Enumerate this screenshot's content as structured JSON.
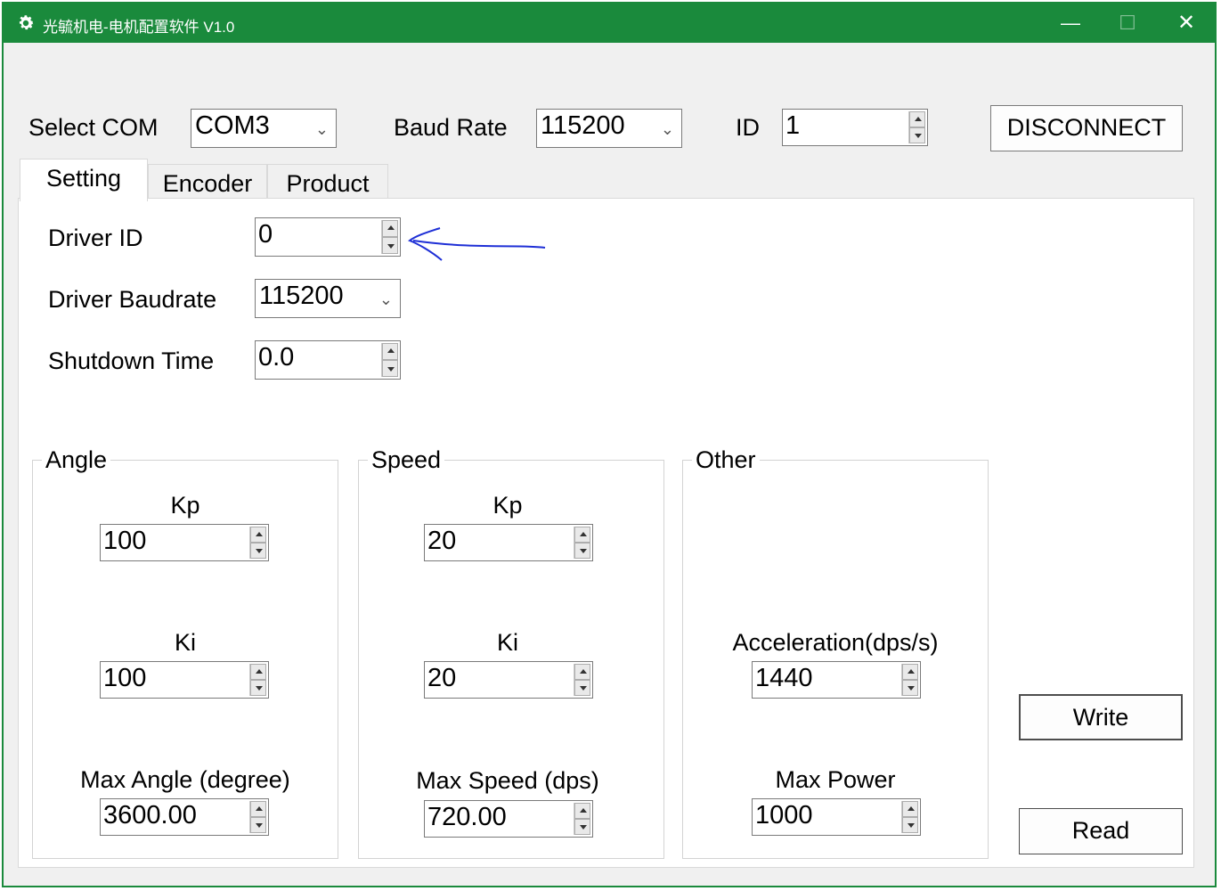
{
  "window": {
    "title": "光毓机电-电机配置软件 V1.0",
    "minimize_glyph": "—",
    "maximize_glyph": "☐",
    "close_glyph": "✕",
    "accent_color": "#1a8a3c",
    "icon": "gear-icon"
  },
  "connection": {
    "com_label": "Select COM",
    "com_value": "COM3",
    "baud_label": "Baud Rate",
    "baud_value": "115200",
    "id_label": "ID",
    "id_value": "1",
    "disconnect_label": "DISCONNECT"
  },
  "tabs": [
    {
      "label": "Setting",
      "active": true
    },
    {
      "label": "Encoder",
      "active": false
    },
    {
      "label": "Product",
      "active": false
    }
  ],
  "setting": {
    "driver_id_label": "Driver ID",
    "driver_id_value": "0",
    "driver_baud_label": "Driver Baudrate",
    "driver_baud_value": "115200",
    "shutdown_label": "Shutdown Time",
    "shutdown_value": "0.0"
  },
  "angle": {
    "title": "Angle",
    "kp_label": "Kp",
    "kp_value": "100",
    "ki_label": "Ki",
    "ki_value": "100",
    "max_label": "Max Angle (degree)",
    "max_value": "3600.00"
  },
  "speed": {
    "title": "Speed",
    "kp_label": "Kp",
    "kp_value": "20",
    "ki_label": "Ki",
    "ki_value": "20",
    "max_label": "Max Speed (dps)",
    "max_value": "720.00"
  },
  "other": {
    "title": "Other",
    "accel_label": "Acceleration(dps/s)",
    "accel_value": "1440",
    "power_label": "Max Power",
    "power_value": "1000"
  },
  "actions": {
    "write_label": "Write",
    "read_label": "Read"
  }
}
